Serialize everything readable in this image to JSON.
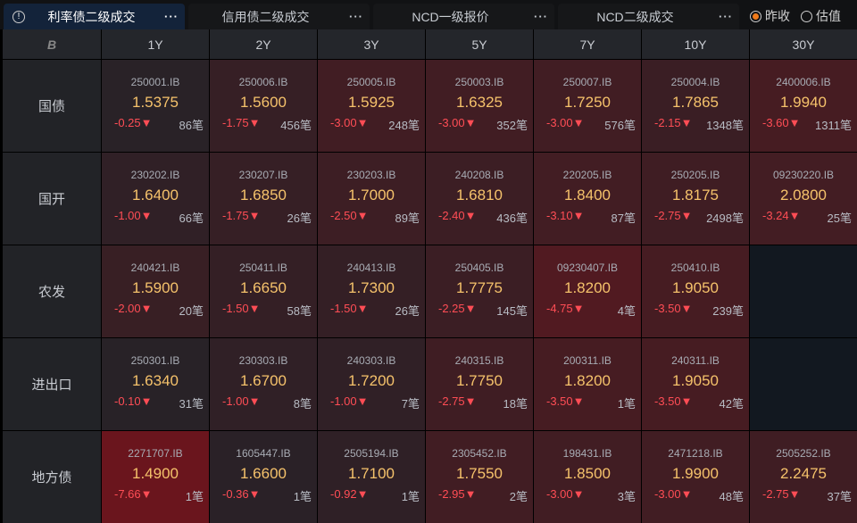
{
  "tabs": [
    {
      "label": "利率债二级成交",
      "active": true
    },
    {
      "label": "信用债二级成交"
    },
    {
      "label": "NCD一级报价"
    },
    {
      "label": "NCD二级成交"
    }
  ],
  "more_label": "···",
  "info_label": "!",
  "radios": [
    {
      "label": "昨收",
      "checked": true
    },
    {
      "label": "估值",
      "checked": false
    }
  ],
  "corner_logo": "B",
  "columns": [
    "1Y",
    "2Y",
    "3Y",
    "5Y",
    "7Y",
    "10Y",
    "30Y"
  ],
  "colors": {
    "base": "#272227",
    "max": "#6a151d",
    "empty": "#121820"
  },
  "rows": [
    {
      "label": "国债",
      "cells": [
        {
          "code": "250001.IB",
          "yield": "1.5375",
          "change": "-0.25▼",
          "count": "86笔",
          "v": 0.25
        },
        {
          "code": "250006.IB",
          "yield": "1.5600",
          "change": "-1.75▼",
          "count": "456笔",
          "v": 1.75
        },
        {
          "code": "250005.IB",
          "yield": "1.5925",
          "change": "-3.00▼",
          "count": "248笔",
          "v": 3.0
        },
        {
          "code": "250003.IB",
          "yield": "1.6325",
          "change": "-3.00▼",
          "count": "352笔",
          "v": 3.0
        },
        {
          "code": "250007.IB",
          "yield": "1.7250",
          "change": "-3.00▼",
          "count": "576笔",
          "v": 3.0
        },
        {
          "code": "250004.IB",
          "yield": "1.7865",
          "change": "-2.15▼",
          "count": "1348笔",
          "v": 2.15
        },
        {
          "code": "2400006.IB",
          "yield": "1.9940",
          "change": "-3.60▼",
          "count": "1311笔",
          "v": 3.6
        }
      ]
    },
    {
      "label": "国开",
      "cells": [
        {
          "code": "230202.IB",
          "yield": "1.6400",
          "change": "-1.00▼",
          "count": "66笔",
          "v": 1.0
        },
        {
          "code": "230207.IB",
          "yield": "1.6850",
          "change": "-1.75▼",
          "count": "26笔",
          "v": 1.75
        },
        {
          "code": "230203.IB",
          "yield": "1.7000",
          "change": "-2.50▼",
          "count": "89笔",
          "v": 2.5
        },
        {
          "code": "240208.IB",
          "yield": "1.6810",
          "change": "-2.40▼",
          "count": "436笔",
          "v": 2.4
        },
        {
          "code": "220205.IB",
          "yield": "1.8400",
          "change": "-3.10▼",
          "count": "87笔",
          "v": 3.1
        },
        {
          "code": "250205.IB",
          "yield": "1.8175",
          "change": "-2.75▼",
          "count": "2498笔",
          "v": 2.75
        },
        {
          "code": "09230220.IB",
          "yield": "2.0800",
          "change": "-3.24▼",
          "count": "25笔",
          "v": 3.24
        }
      ]
    },
    {
      "label": "农发",
      "cells": [
        {
          "code": "240421.IB",
          "yield": "1.5900",
          "change": "-2.00▼",
          "count": "20笔",
          "v": 2.0
        },
        {
          "code": "250411.IB",
          "yield": "1.6650",
          "change": "-1.50▼",
          "count": "58笔",
          "v": 1.5
        },
        {
          "code": "240413.IB",
          "yield": "1.7300",
          "change": "-1.50▼",
          "count": "26笔",
          "v": 1.5
        },
        {
          "code": "250405.IB",
          "yield": "1.7775",
          "change": "-2.25▼",
          "count": "145笔",
          "v": 2.25
        },
        {
          "code": "09230407.IB",
          "yield": "1.8200",
          "change": "-4.75▼",
          "count": "4笔",
          "v": 4.75
        },
        {
          "code": "250410.IB",
          "yield": "1.9050",
          "change": "-3.50▼",
          "count": "239笔",
          "v": 3.5
        },
        null
      ]
    },
    {
      "label": "进出口",
      "cells": [
        {
          "code": "250301.IB",
          "yield": "1.6340",
          "change": "-0.10▼",
          "count": "31笔",
          "v": 0.1
        },
        {
          "code": "230303.IB",
          "yield": "1.6700",
          "change": "-1.00▼",
          "count": "8笔",
          "v": 1.0
        },
        {
          "code": "240303.IB",
          "yield": "1.7200",
          "change": "-1.00▼",
          "count": "7笔",
          "v": 1.0
        },
        {
          "code": "240315.IB",
          "yield": "1.7750",
          "change": "-2.75▼",
          "count": "18笔",
          "v": 2.75
        },
        {
          "code": "200311.IB",
          "yield": "1.8200",
          "change": "-3.50▼",
          "count": "1笔",
          "v": 3.5
        },
        {
          "code": "240311.IB",
          "yield": "1.9050",
          "change": "-3.50▼",
          "count": "42笔",
          "v": 3.5
        },
        null
      ]
    },
    {
      "label": "地方债",
      "cells": [
        {
          "code": "2271707.IB",
          "yield": "1.4900",
          "change": "-7.66▼",
          "count": "1笔",
          "v": 7.66
        },
        {
          "code": "1605447.IB",
          "yield": "1.6600",
          "change": "-0.36▼",
          "count": "1笔",
          "v": 0.36
        },
        {
          "code": "2505194.IB",
          "yield": "1.7100",
          "change": "-0.92▼",
          "count": "1笔",
          "v": 0.92
        },
        {
          "code": "2305452.IB",
          "yield": "1.7550",
          "change": "-2.95▼",
          "count": "2笔",
          "v": 2.95
        },
        {
          "code": "198431.IB",
          "yield": "1.8500",
          "change": "-3.00▼",
          "count": "3笔",
          "v": 3.0
        },
        {
          "code": "2471218.IB",
          "yield": "1.9900",
          "change": "-3.00▼",
          "count": "48笔",
          "v": 3.0
        },
        {
          "code": "2505252.IB",
          "yield": "2.2475",
          "change": "-2.75▼",
          "count": "37笔",
          "v": 2.75
        }
      ]
    }
  ]
}
